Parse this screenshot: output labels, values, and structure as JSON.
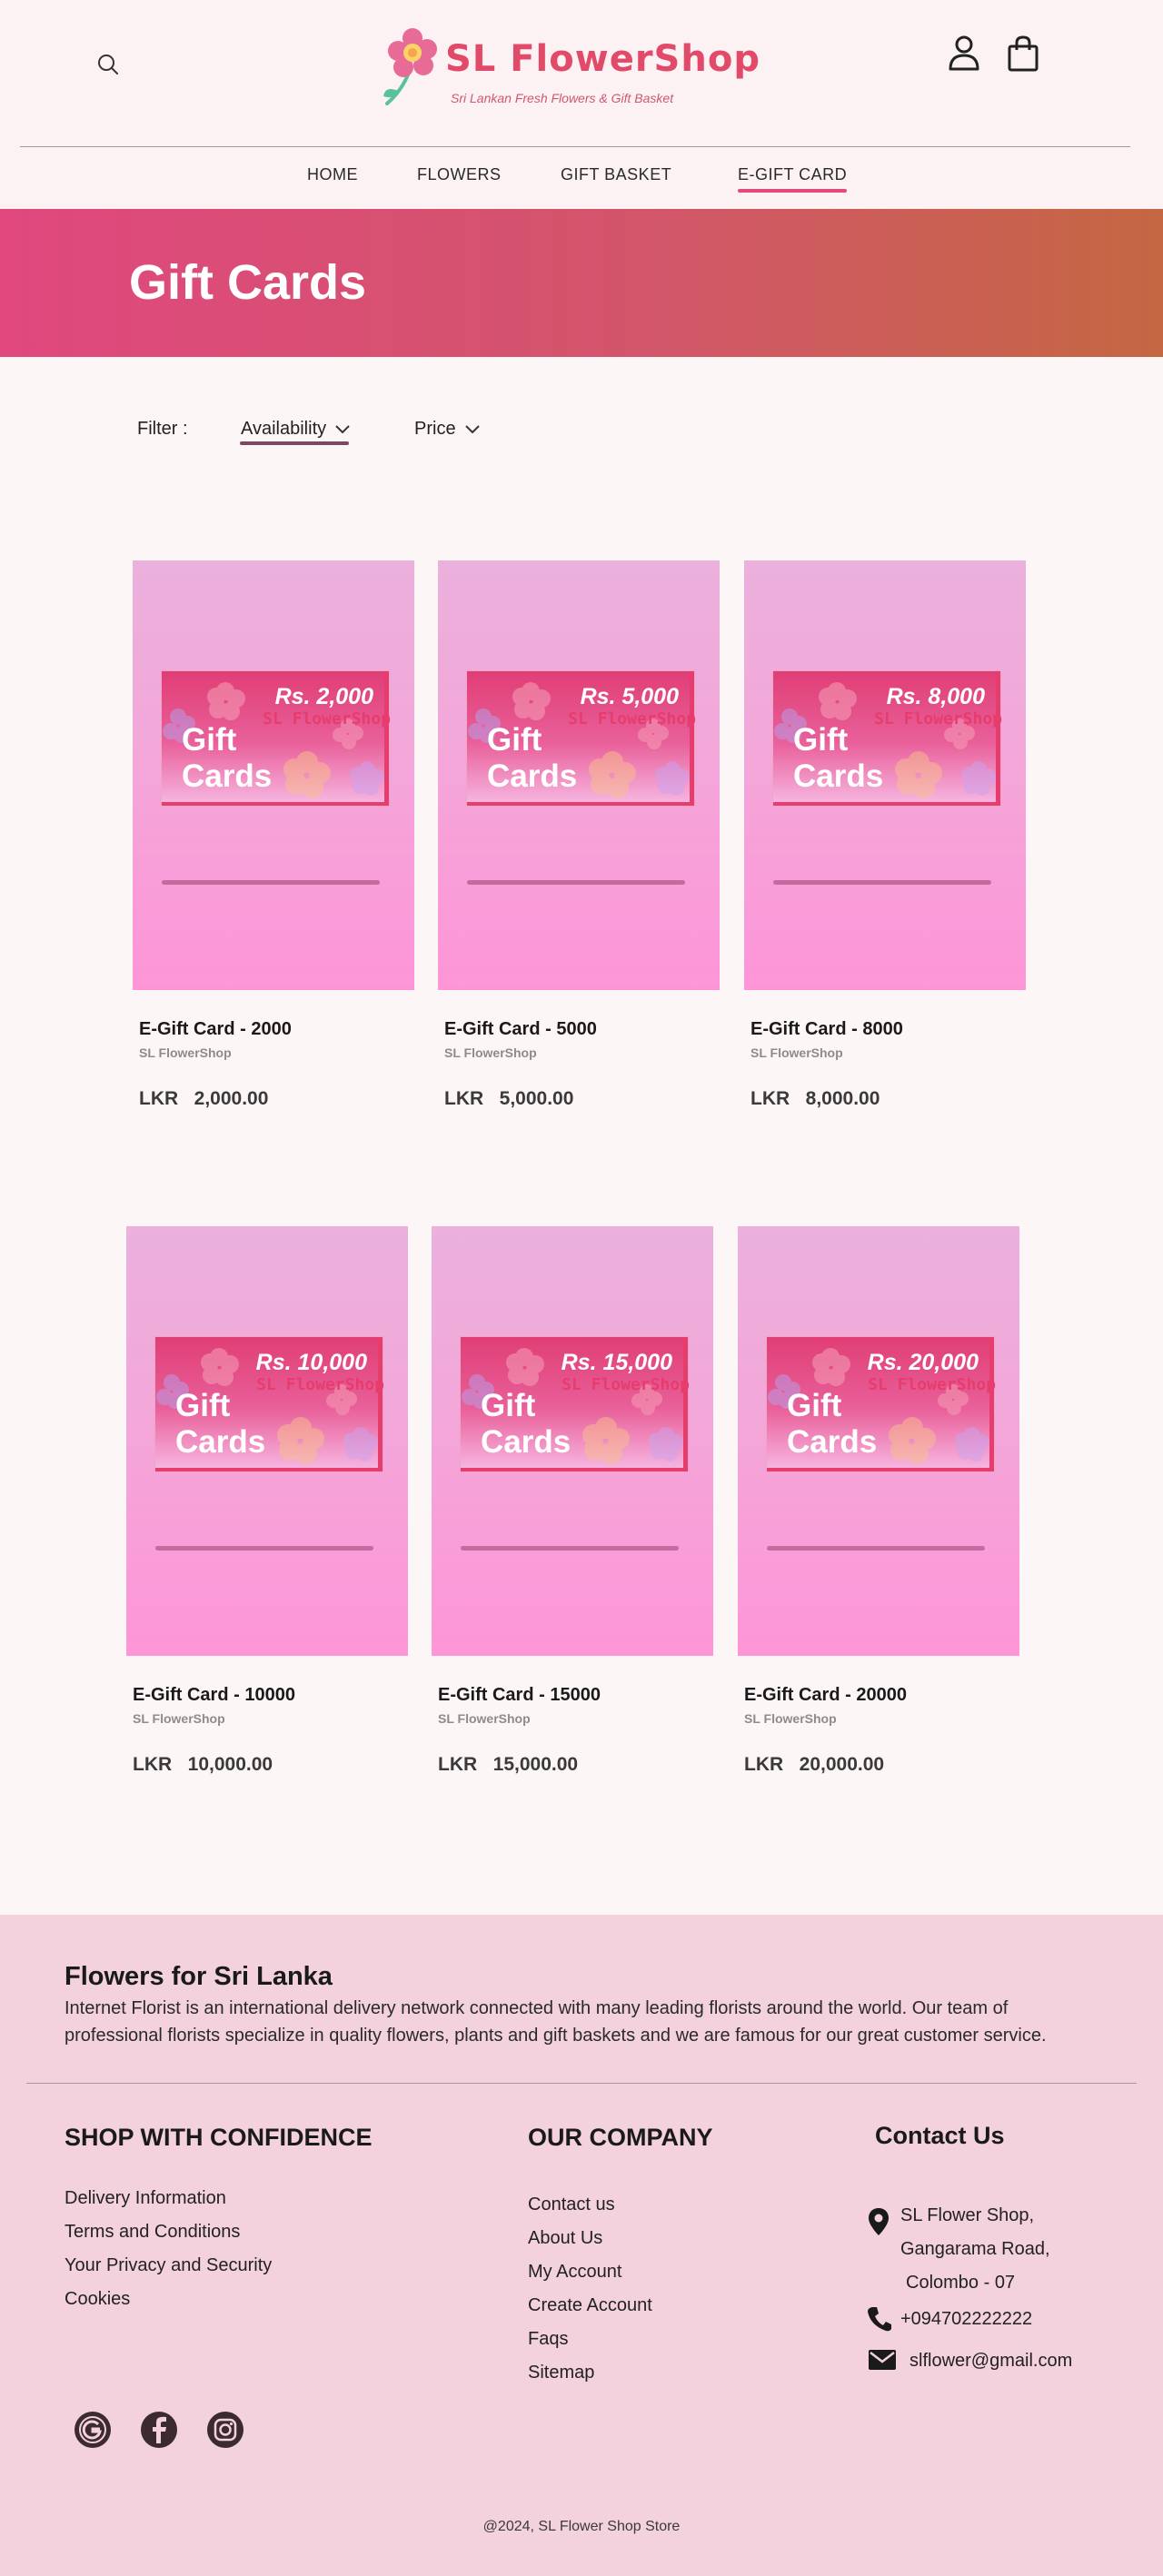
{
  "header": {
    "brand_title": "SL  FlowerShop",
    "brand_subtitle": "Sri Lankan Fresh Flowers & Gift Basket",
    "icons": {
      "search": "search-icon",
      "account": "user-icon",
      "cart": "shopping-bag-icon"
    },
    "nav": [
      {
        "label": "HOME",
        "active": false
      },
      {
        "label": "FLOWERS",
        "active": false
      },
      {
        "label": "GIFT BASKET",
        "active": false
      },
      {
        "label": "E-GIFT CARD",
        "active": true
      }
    ]
  },
  "banner": {
    "title": "Gift Cards"
  },
  "filter": {
    "label": "Filter :",
    "availability": "Availability",
    "price": "Price"
  },
  "card_image": {
    "word1": "Gift",
    "word2": "Cards",
    "brand": "SL FlowerShop"
  },
  "products": [
    {
      "card_amount": "Rs. 2,000",
      "name": "E-Gift Card  -  2000",
      "vendor": "SL  FlowerShop",
      "price": "LKR   2,000.00"
    },
    {
      "card_amount": "Rs. 5,000",
      "name": "E-Gift Card  -  5000",
      "vendor": "SL  FlowerShop",
      "price": "LKR   5,000.00"
    },
    {
      "card_amount": "Rs. 8,000",
      "name": "E-Gift Card  -  8000",
      "vendor": "SL  FlowerShop",
      "price": "LKR   8,000.00"
    },
    {
      "card_amount": "Rs. 10,000",
      "name": "E-Gift Card  -  10000",
      "vendor": "SL  FlowerShop",
      "price": "LKR   10,000.00"
    },
    {
      "card_amount": "Rs. 15,000",
      "name": "E-Gift Card  -  15000",
      "vendor": "SL  FlowerShop",
      "price": "LKR   15,000.00"
    },
    {
      "card_amount": "Rs. 20,000",
      "name": "E-Gift Card  -  20000",
      "vendor": "SL  FlowerShop",
      "price": "LKR   20,000.00"
    }
  ],
  "footer": {
    "title": "Flowers for Sri Lanka",
    "description": "Internet Florist is an international delivery network connected with many leading florists around the world. Our team of professional florists specialize in quality flowers, plants and gift baskets and we are famous for our great customer service.",
    "shop": {
      "title": "SHOP WITH CONFIDENCE",
      "links": [
        "Delivery Information",
        "Terms and Conditions",
        "Your Privacy and Security",
        "Cookies"
      ]
    },
    "company": {
      "title": "OUR COMPANY",
      "links": [
        "Contact us",
        "About Us",
        "My Account",
        "Create Account",
        "Faqs",
        "Sitemap"
      ]
    },
    "contact": {
      "title": "Contact Us",
      "address_lines": [
        "SL Flower Shop,",
        "Gangarama Road,",
        "Colombo - 07"
      ],
      "phone": "+094702222222",
      "email": "slflower@gmail.com"
    },
    "social_icons": [
      "google-icon",
      "facebook-icon",
      "instagram-icon"
    ],
    "copyright": "@2024, SL Flower Shop Store"
  },
  "colors": {
    "accent": "#e14a68",
    "banner_start": "#e0487e",
    "banner_end": "#c46742",
    "footer_bg": "#f3d1dd",
    "card_bg": "#fe95d7"
  }
}
